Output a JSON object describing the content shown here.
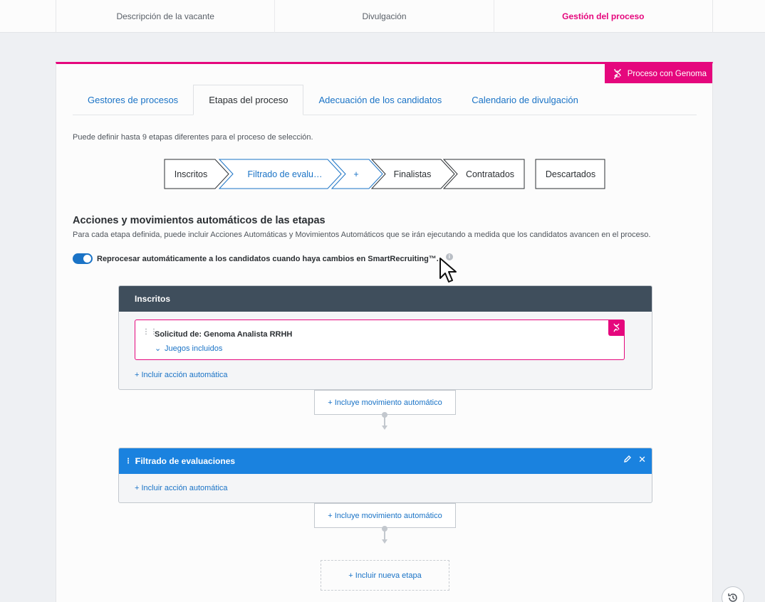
{
  "top_tabs": [
    "Descripción de la vacante",
    "Divulgación",
    "Gestión del proceso"
  ],
  "badge": {
    "label": "Proceso con Genoma"
  },
  "sub_tabs": [
    "Gestores de procesos",
    "Etapas del proceso",
    "Adecuación de los candidatos",
    "Calendario de divulgación"
  ],
  "info_text": "Puede definir hasta 9 etapas diferentes para el proceso de selección.",
  "stages": {
    "inscritos": "Inscritos",
    "filtrado": "Filtrado de evalu…",
    "add": "+",
    "finalistas": "Finalistas",
    "contratados": "Contratados",
    "descartados": "Descartados"
  },
  "section": {
    "title": "Acciones y movimientos automáticos de las etapas",
    "description": "Para cada etapa definida, puede incluir Acciones Automáticas y Movimientos Automáticos que se irán ejecutando a medida que los candidatos avancen en el proceso.",
    "toggle_label": "Reprocesar automáticamente a los candidatos cuando haya cambios en SmartRecruiting™.",
    "toggle_on": true
  },
  "block1": {
    "title": "Inscritos",
    "action_title": "Solicitud de: Genoma Analista RRHH",
    "action_link": "Juegos incluidos",
    "add_action": "+ Incluir acción automática",
    "add_move": "+ Incluye movimiento automático"
  },
  "block2": {
    "title": "Filtrado de evaluaciones",
    "add_action": "+ Incluir acción automática",
    "add_move": "+ Incluye movimiento automático"
  },
  "new_stage": "+ Incluir nueva etapa",
  "colors": {
    "accent": "#e5077d",
    "link": "#1a73c6",
    "stage_header_dark": "#3f4e5c",
    "stage_header_blue": "#1a82df"
  }
}
